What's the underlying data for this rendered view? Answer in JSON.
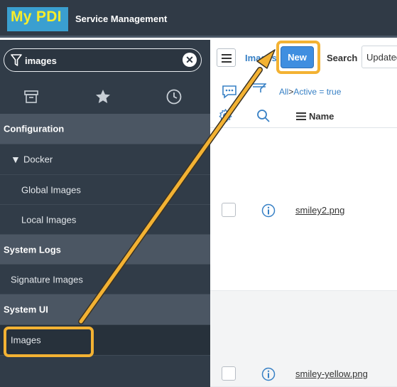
{
  "header": {
    "logo_text": "My PDI",
    "app_title": "Service Management"
  },
  "sidebar": {
    "filter_value": "images",
    "tabs": [
      {
        "icon": "archive-icon"
      },
      {
        "icon": "star-icon"
      },
      {
        "icon": "clock-icon"
      }
    ],
    "items": [
      {
        "label": "Configuration"
      },
      {
        "label": "Docker"
      },
      {
        "label": "Global Images"
      },
      {
        "label": "Local Images"
      },
      {
        "label": "System Logs"
      },
      {
        "label": "Signature Images"
      },
      {
        "label": "System UI"
      },
      {
        "label": "Images"
      }
    ]
  },
  "list": {
    "title": "Images",
    "new_label": "New",
    "search_label": "Search",
    "search_field": "Updated",
    "breadcrumb_all": "All",
    "breadcrumb_sep": ">",
    "breadcrumb_filter": "Active = true",
    "column_name": "Name",
    "rows": [
      {
        "name": "smiley2.png"
      },
      {
        "name": "smiley-yellow.png"
      }
    ]
  },
  "colors": {
    "highlight": "#f3b233",
    "accent": "#3f8ee0",
    "sidebar": "#313c48"
  }
}
